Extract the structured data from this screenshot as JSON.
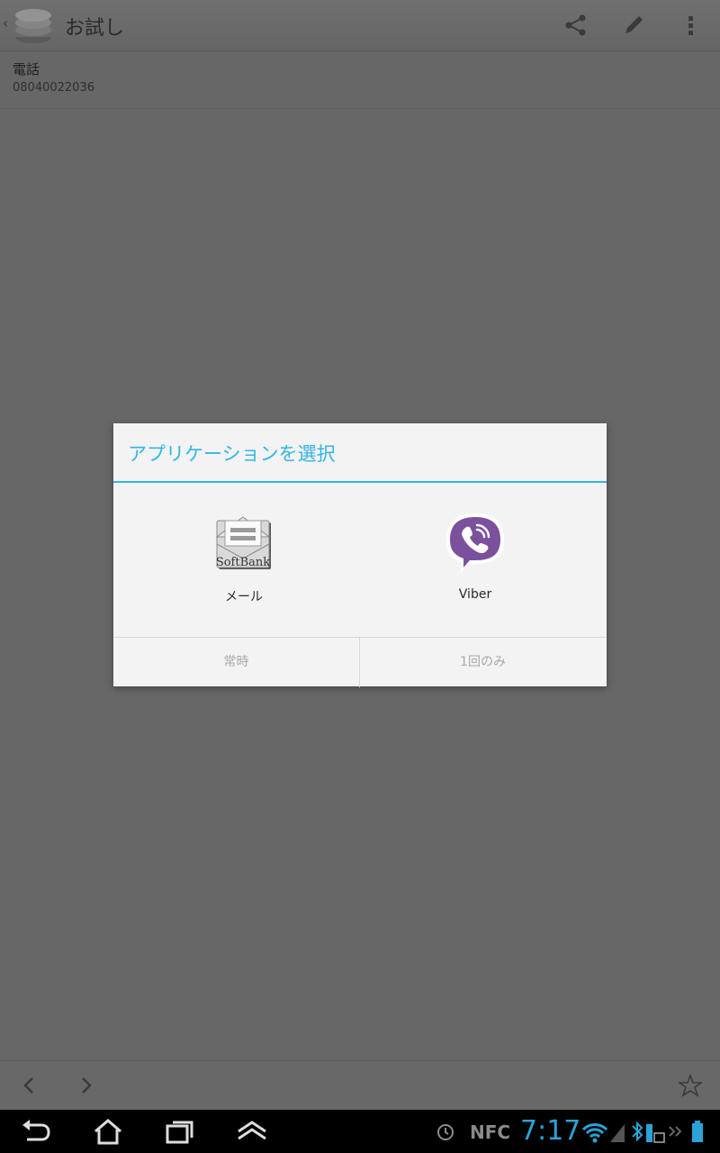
{
  "actionbar": {
    "title": "お試し",
    "icons": [
      "app-icon",
      "share-icon",
      "edit-icon",
      "overflow-menu-icon"
    ]
  },
  "detail": {
    "label": "電話",
    "value": "08040022036"
  },
  "dialog": {
    "title": "アプリケーションを選択",
    "options": [
      {
        "label": "メール",
        "icon": "softbank-mail-icon",
        "icon_text": "SoftBank"
      },
      {
        "label": "Viber",
        "icon": "viber-icon"
      }
    ],
    "buttons": {
      "always": "常時",
      "once": "1回のみ"
    }
  },
  "bottombar": {
    "icons": [
      "chevron-left-icon",
      "chevron-right-icon",
      "star-icon"
    ]
  },
  "navbar": {
    "icons": [
      "back-icon",
      "home-icon",
      "recent-apps-icon",
      "up-icon"
    ]
  },
  "status": {
    "time": "7:17",
    "nfc": "NFC",
    "icons": [
      "alarm-icon",
      "wifi-icon",
      "signal-icon",
      "bluetooth-icon",
      "sim-icon",
      "battery-icon"
    ]
  },
  "colors": {
    "accent": "#33b5e5",
    "viber": "#7b519d",
    "overlay": "#676767"
  }
}
